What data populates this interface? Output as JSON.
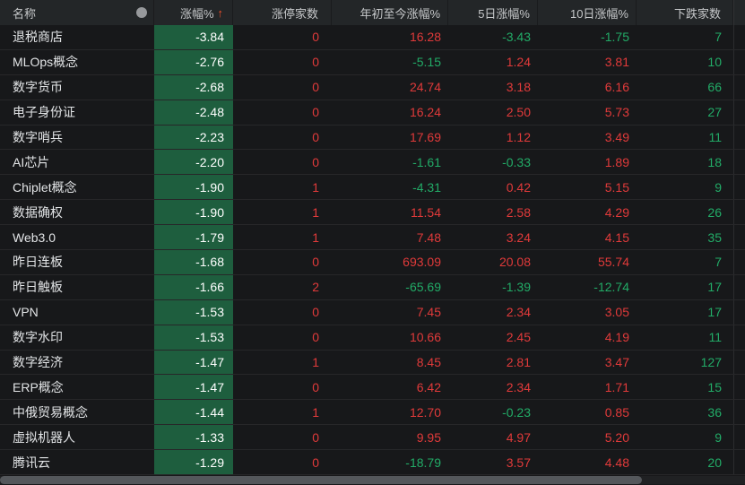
{
  "colors": {
    "background": "#17181a",
    "header_background": "#232628",
    "change_cell_background": "#1e5e3e",
    "up_text": "#e03a3a",
    "down_text": "#22ab67",
    "sort_arrow": "#f04f2a",
    "scroll_thumb": "#54575b"
  },
  "table": {
    "columns": [
      {
        "key": "name",
        "label": "名称"
      },
      {
        "key": "chg",
        "label": "涨幅%"
      },
      {
        "key": "limit_up",
        "label": "涨停家数"
      },
      {
        "key": "ytd",
        "label": "年初至今涨幅%"
      },
      {
        "key": "d5",
        "label": "5日涨幅%"
      },
      {
        "key": "d10",
        "label": "10日涨幅%"
      },
      {
        "key": "decliners",
        "label": "下跌家数"
      }
    ],
    "sort": {
      "column": "chg",
      "direction": "ascending",
      "arrow": "↑"
    },
    "rows": [
      {
        "name": "退税商店",
        "chg": "-3.84",
        "limit_up": "0",
        "ytd": "16.28",
        "d5": "-3.43",
        "d10": "-1.75",
        "decliners": "7"
      },
      {
        "name": "MLOps概念",
        "chg": "-2.76",
        "limit_up": "0",
        "ytd": "-5.15",
        "d5": "1.24",
        "d10": "3.81",
        "decliners": "10"
      },
      {
        "name": "数字货币",
        "chg": "-2.68",
        "limit_up": "0",
        "ytd": "24.74",
        "d5": "3.18",
        "d10": "6.16",
        "decliners": "66"
      },
      {
        "name": "电子身份证",
        "chg": "-2.48",
        "limit_up": "0",
        "ytd": "16.24",
        "d5": "2.50",
        "d10": "5.73",
        "decliners": "27"
      },
      {
        "name": "数字哨兵",
        "chg": "-2.23",
        "limit_up": "0",
        "ytd": "17.69",
        "d5": "1.12",
        "d10": "3.49",
        "decliners": "11"
      },
      {
        "name": "AI芯片",
        "chg": "-2.20",
        "limit_up": "0",
        "ytd": "-1.61",
        "d5": "-0.33",
        "d10": "1.89",
        "decliners": "18"
      },
      {
        "name": "Chiplet概念",
        "chg": "-1.90",
        "limit_up": "1",
        "ytd": "-4.31",
        "d5": "0.42",
        "d10": "5.15",
        "decliners": "9"
      },
      {
        "name": "数据确权",
        "chg": "-1.90",
        "limit_up": "1",
        "ytd": "11.54",
        "d5": "2.58",
        "d10": "4.29",
        "decliners": "26"
      },
      {
        "name": "Web3.0",
        "chg": "-1.79",
        "limit_up": "1",
        "ytd": "7.48",
        "d5": "3.24",
        "d10": "4.15",
        "decliners": "35"
      },
      {
        "name": "昨日连板",
        "chg": "-1.68",
        "limit_up": "0",
        "ytd": "693.09",
        "d5": "20.08",
        "d10": "55.74",
        "decliners": "7"
      },
      {
        "name": "昨日触板",
        "chg": "-1.66",
        "limit_up": "2",
        "ytd": "-65.69",
        "d5": "-1.39",
        "d10": "-12.74",
        "decliners": "17"
      },
      {
        "name": "VPN",
        "chg": "-1.53",
        "limit_up": "0",
        "ytd": "7.45",
        "d5": "2.34",
        "d10": "3.05",
        "decliners": "17"
      },
      {
        "name": "数字水印",
        "chg": "-1.53",
        "limit_up": "0",
        "ytd": "10.66",
        "d5": "2.45",
        "d10": "4.19",
        "decliners": "11"
      },
      {
        "name": "数字经济",
        "chg": "-1.47",
        "limit_up": "1",
        "ytd": "8.45",
        "d5": "2.81",
        "d10": "3.47",
        "decliners": "127"
      },
      {
        "name": "ERP概念",
        "chg": "-1.47",
        "limit_up": "0",
        "ytd": "6.42",
        "d5": "2.34",
        "d10": "1.71",
        "decliners": "15"
      },
      {
        "name": "中俄贸易概念",
        "chg": "-1.44",
        "limit_up": "1",
        "ytd": "12.70",
        "d5": "-0.23",
        "d10": "0.85",
        "decliners": "36"
      },
      {
        "name": "虚拟机器人",
        "chg": "-1.33",
        "limit_up": "0",
        "ytd": "9.95",
        "d5": "4.97",
        "d10": "5.20",
        "decliners": "9"
      },
      {
        "name": "腾讯云",
        "chg": "-1.29",
        "limit_up": "0",
        "ytd": "-18.79",
        "d5": "3.57",
        "d10": "4.48",
        "decliners": "20"
      }
    ]
  }
}
